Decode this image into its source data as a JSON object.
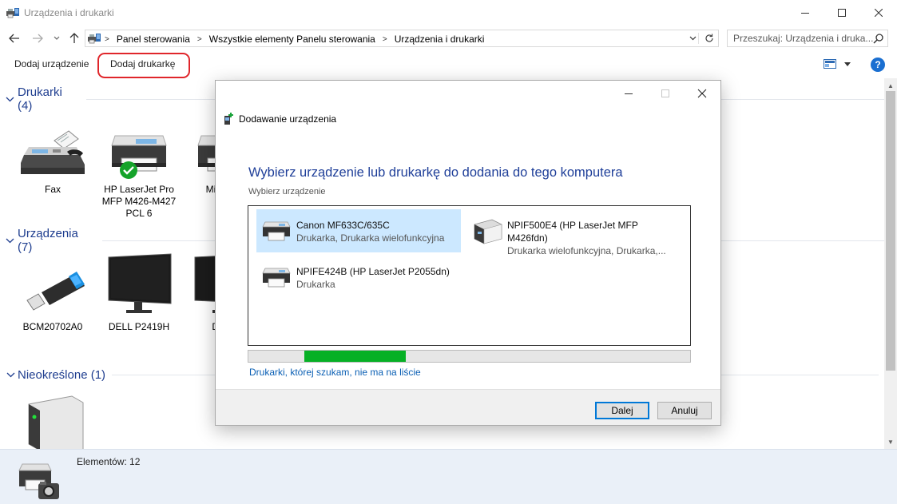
{
  "window": {
    "title": "Urządzenia i drukarki"
  },
  "nav": {
    "breadcrumbs": [
      "Panel sterowania",
      "Wszystkie elementy Panelu sterowania",
      "Urządzenia i drukarki"
    ],
    "search_placeholder": "Przeszukaj: Urządzenia i druka..."
  },
  "toolbar": {
    "add_device": "Dodaj urządzenie",
    "add_printer": "Dodaj drukarkę",
    "help": "?"
  },
  "groups": {
    "printers": {
      "title": "Drukarki (4)",
      "items": [
        {
          "label": "Fax",
          "icon": "fax-icon"
        },
        {
          "label": "HP LaserJet Pro MFP M426-M427 PCL 6",
          "icon": "printer-icon",
          "default": true
        },
        {
          "label": "Micr... t...",
          "icon": "printer-icon"
        }
      ]
    },
    "devices": {
      "title": "Urządzenia (7)",
      "items": [
        {
          "label": "BCM20702A0",
          "icon": "usb-dongle-icon"
        },
        {
          "label": "DELL P2419H",
          "icon": "monitor-icon"
        },
        {
          "label": "DEL...",
          "icon": "monitor-icon"
        }
      ]
    },
    "unspecified": {
      "title": "Nieokreślone (1)",
      "items": [
        {
          "label": "",
          "icon": "computer-tower-icon"
        }
      ]
    }
  },
  "details": {
    "count_text": "Elementów: 12"
  },
  "dialog": {
    "title": "Dodawanie urządzenia",
    "heading": "Wybierz urządzenie lub drukarkę do dodania do tego komputera",
    "subheading": "Wybierz urządzenie",
    "devices": [
      {
        "name": "Canon MF633C/635C",
        "type": "Drukarka, Drukarka wielofunkcyjna",
        "selected": true
      },
      {
        "name": "NPIF500E4 (HP LaserJet MFP",
        "name2": "M426fdn)",
        "type": "Drukarka wielofunkcyjna, Drukarka,..."
      },
      {
        "name": "NPIFE424B (HP LaserJet P2055dn)",
        "type": "Drukarka"
      }
    ],
    "progress_fraction": 0.23,
    "not_listed_link": "Drukarki, której szukam, nie ma na liście",
    "next_button": "Dalej",
    "cancel_button": "Anuluj"
  },
  "colors": {
    "accent": "#1f3f99",
    "group_title": "#1e3d8f",
    "progress": "#06b025",
    "highlight_ring": "#e0262b",
    "selection": "#cce8ff"
  }
}
